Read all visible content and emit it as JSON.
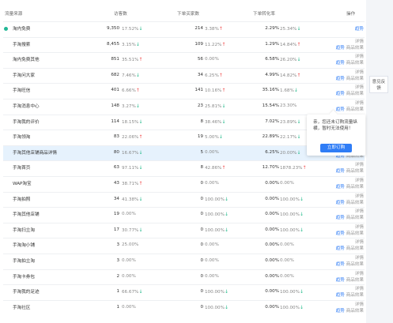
{
  "header": {
    "source": "流量来源",
    "visitors": "访客数",
    "buyers": "下单买家数",
    "conversion": "下单转化率",
    "ops": "操作"
  },
  "ops": {
    "detail": "详情",
    "trend": "趋势",
    "effect": "商品效果"
  },
  "rows": [
    {
      "name": "淘内免费",
      "v1": "9,350",
      "p1": "17.52%",
      "a1": "down",
      "v2": "214",
      "p2": "3.38%",
      "a2": "up",
      "v3": "2.29%",
      "p3": "25.34%",
      "a3": "down",
      "dot": true,
      "ops": "trend"
    },
    {
      "name": "手淘搜索",
      "v1": "8,455",
      "p1": "3.15%",
      "a1": "down",
      "v2": "109",
      "p2": "11.22%",
      "a2": "up",
      "v3": "1.29%",
      "p3": "14.84%",
      "a3": "up",
      "ops": "full"
    },
    {
      "name": "淘内免费其他",
      "v1": "851",
      "p1": "35.51%",
      "a1": "up",
      "v2": "56",
      "p2": "0.00%",
      "a2": "",
      "v3": "6.58%",
      "p3": "26.20%",
      "a3": "down",
      "ops": "full"
    },
    {
      "name": "手淘问大家",
      "v1": "682",
      "p1": "7.46%",
      "a1": "down",
      "v2": "34",
      "p2": "6.25%",
      "a2": "up",
      "v3": "4.99%",
      "p3": "14.82%",
      "a3": "up",
      "ops": "full"
    },
    {
      "name": "手淘旺信",
      "v1": "401",
      "p1": "6.66%",
      "a1": "up",
      "v2": "141",
      "p2": "10.16%",
      "a2": "up",
      "v3": "35.16%",
      "p3": "1.68%",
      "a3": "down",
      "ops": "full"
    },
    {
      "name": "手淘消息中心",
      "v1": "148",
      "p1": "3.27%",
      "a1": "down",
      "v2": "23",
      "p2": "25.81%",
      "a2": "down",
      "v3": "15.54%",
      "p3": "23.30%",
      "a3": "",
      "ops": "full"
    },
    {
      "name": "手淘我的评价",
      "v1": "114",
      "p1": "18.15%",
      "a1": "down",
      "v2": "8",
      "p2": "38.46%",
      "a2": "down",
      "v3": "7.02%",
      "p3": "23.89%",
      "a3": "down",
      "ops": "full"
    },
    {
      "name": "手淘领淘",
      "v1": "83",
      "p1": "22.06%",
      "a1": "up",
      "v2": "19",
      "p2": "5.00%",
      "a2": "down",
      "v3": "22.89%",
      "p3": "22.17%",
      "a3": "down",
      "ops": "full"
    },
    {
      "name": "手淘其他店铺商品详情",
      "v1": "80",
      "p1": "16.67%",
      "a1": "down",
      "v2": "5",
      "p2": "0.00%",
      "a2": "",
      "v3": "6.25%",
      "p3": "20.00%",
      "a3": "down",
      "hl": true,
      "ops": "full"
    },
    {
      "name": "手淘首页",
      "v1": "63",
      "p1": "97.11%",
      "a1": "down",
      "v2": "8",
      "p2": "42.86%",
      "a2": "up",
      "v3": "12.70%",
      "p3": "1878.23%",
      "a3": "up",
      "ops": "full"
    },
    {
      "name": "WAP淘宝",
      "v1": "43",
      "p1": "38.71%",
      "a1": "up",
      "v2": "0",
      "p2": "0.00%",
      "a2": "",
      "v3": "0.00%",
      "p3": "0.00%",
      "a3": "",
      "ops": "full"
    },
    {
      "name": "手淘拍照",
      "v1": "34",
      "p1": "41.38%",
      "a1": "down",
      "v2": "0",
      "p2": "100.00%",
      "a2": "down",
      "v3": "0.00%",
      "p3": "100.00%",
      "a3": "down",
      "ops": "full"
    },
    {
      "name": "手淘其他店铺",
      "v1": "19",
      "p1": "0.00%",
      "a1": "",
      "v2": "0",
      "p2": "100.00%",
      "a2": "down",
      "v3": "0.00%",
      "p3": "100.00%",
      "a3": "down",
      "ops": "full"
    },
    {
      "name": "手淘扫立淘",
      "v1": "17",
      "p1": "30.77%",
      "a1": "down",
      "v2": "0",
      "p2": "100.00%",
      "a2": "down",
      "v3": "0.00%",
      "p3": "100.00%",
      "a3": "down",
      "ops": "full"
    },
    {
      "name": "手淘淘小铺",
      "v1": "3",
      "p1": "25.00%",
      "a1": "",
      "v2": "0",
      "p2": "0.00%",
      "a2": "",
      "v3": "0.00%",
      "p3": "0.00%",
      "a3": "",
      "ops": "full"
    },
    {
      "name": "手淘拍立淘",
      "v1": "3",
      "p1": "0.00%",
      "a1": "",
      "v2": "0",
      "p2": "0.00%",
      "a2": "",
      "v3": "0.00%",
      "p3": "0.00%",
      "a3": "",
      "ops": "full"
    },
    {
      "name": "手淘卡券包",
      "v1": "2",
      "p1": "0.00%",
      "a1": "",
      "v2": "0",
      "p2": "0.00%",
      "a2": "",
      "v3": "0.00%",
      "p3": "0.00%",
      "a3": "",
      "ops": "full"
    },
    {
      "name": "手淘我的足迹",
      "v1": "1",
      "p1": "66.67%",
      "a1": "down",
      "v2": "0",
      "p2": "100.00%",
      "a2": "down",
      "v3": "0.00%",
      "p3": "100.00%",
      "a3": "down",
      "ops": "full"
    },
    {
      "name": "手淘社区",
      "v1": "1",
      "p1": "0.00%",
      "a1": "",
      "v2": "0",
      "p2": "100.00%",
      "a2": "down",
      "v3": "0.00%",
      "p3": "100.00%",
      "a3": "down",
      "ops": "full"
    }
  ],
  "side_tab": "意见反馈",
  "popup": {
    "text": "亲，您还未订购流量纵横，暂时无法使用！",
    "button": "立即订购"
  },
  "colors": {
    "up": "#f04e4e",
    "down": "#1fb889",
    "accent": "#2f7df6"
  }
}
